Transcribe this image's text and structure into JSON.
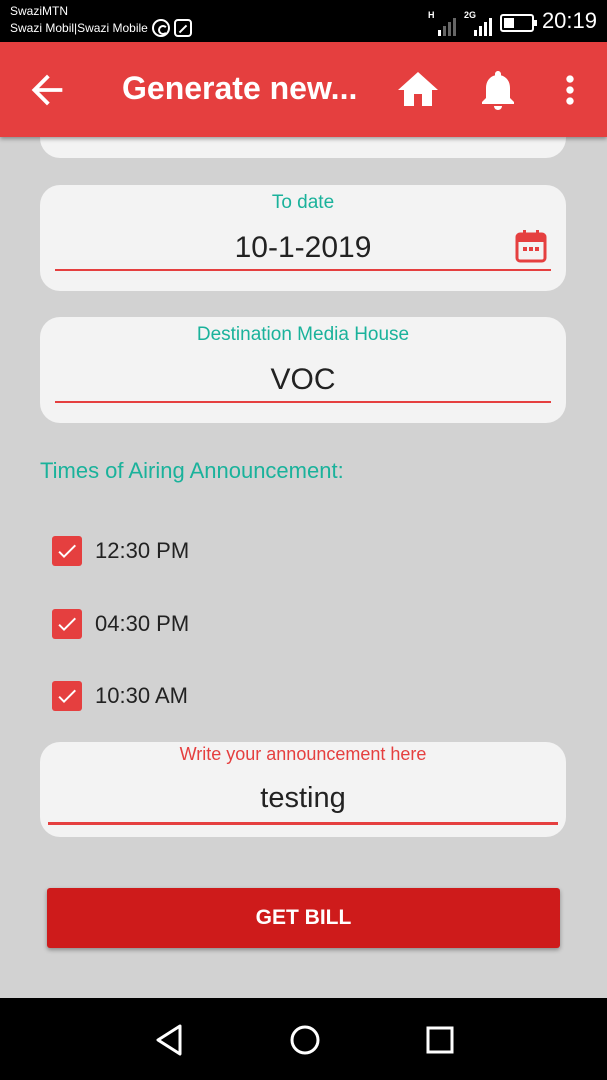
{
  "status_bar": {
    "carrier_1": "SwaziMTN",
    "carrier_2": "Swazi Mobil|Swazi Mobile",
    "network_1": "H",
    "network_2": "2G",
    "battery_level": 0.4,
    "time": "20:19"
  },
  "app_bar": {
    "title": "Generate new...",
    "icons": [
      "arrow-back-icon",
      "home-icon",
      "bell-icon",
      "more-vert-icon"
    ]
  },
  "form": {
    "to_date": {
      "label": "To date",
      "value": "10-1-2019",
      "icon": "calendar-icon"
    },
    "media_house": {
      "label": "Destination Media House",
      "value": "VOC"
    },
    "airing_heading": "Times of Airing Announcement:",
    "airing_times": [
      {
        "label": "12:30 PM",
        "checked": true
      },
      {
        "label": "04:30 PM",
        "checked": true
      },
      {
        "label": "10:30 AM",
        "checked": true
      }
    ],
    "announcement": {
      "placeholder": "Write your announcement here",
      "value": "testing"
    },
    "submit_label": "GET BILL"
  },
  "colors": {
    "primary": "#e53f3f",
    "button": "#ce1b1b",
    "accent_teal": "#1ab29b",
    "background": "#d2d2d2",
    "card": "#f3f3f3"
  },
  "nav_bar": {
    "icons": [
      "back-triangle-icon",
      "home-circle-icon",
      "recents-square-icon"
    ]
  }
}
